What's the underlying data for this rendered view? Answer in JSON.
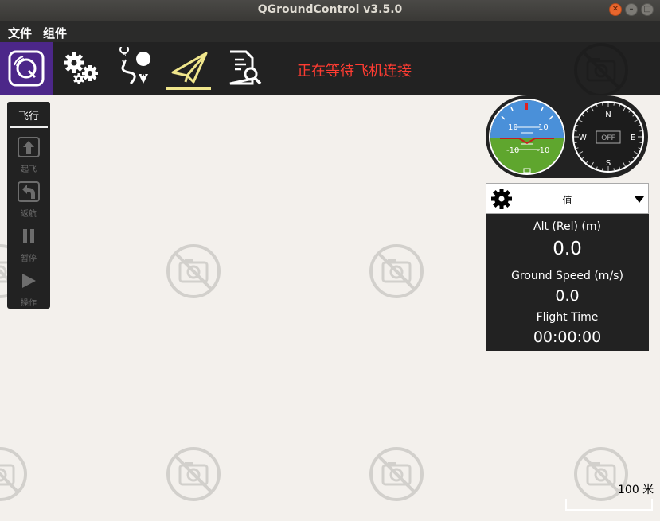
{
  "window": {
    "title": "QGroundControl v3.5.0"
  },
  "menu": {
    "items": [
      "文件",
      "组件"
    ]
  },
  "toolbar": {
    "status_message": "正在等待飞机连接"
  },
  "fly_tools": {
    "header": "飞行",
    "items": [
      {
        "label": "起飞",
        "icon": "takeoff-icon"
      },
      {
        "label": "返航",
        "icon": "return-icon"
      },
      {
        "label": "暂停",
        "icon": "pause-icon"
      },
      {
        "label": "操作",
        "icon": "action-icon"
      }
    ]
  },
  "attitude": {
    "pitch_top_left": "10",
    "pitch_top_right": "10",
    "pitch_bottom_left": "-10",
    "pitch_bottom_right": "-10"
  },
  "compass": {
    "n": "N",
    "e": "E",
    "s": "S",
    "w": "W",
    "status": "OFF"
  },
  "values_widget": {
    "title": "值",
    "rows": [
      {
        "label": "Alt (Rel) (m)",
        "value": "0.0"
      },
      {
        "label": "Ground Speed (m/s)",
        "value": "0.0"
      },
      {
        "label": "Flight Time",
        "value": "00:00:00"
      }
    ]
  },
  "map": {
    "scale_label": "100 米"
  },
  "colors": {
    "toolbar_bg": "#222222",
    "logo_bg": "#4c2789",
    "status_text": "#ff3c32",
    "active_indicator": "#f0e68c",
    "map_bg": "#f3f0ec"
  }
}
